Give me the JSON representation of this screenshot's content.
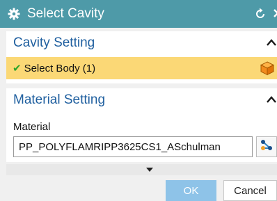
{
  "dialog": {
    "title": "Select Cavity",
    "title_bar_color": "#4e9aa8",
    "icons": [
      "gear-icon",
      "reset-icon",
      "close-icon"
    ]
  },
  "cavity_setting": {
    "header": "Cavity Setting",
    "select_label": "Select Body (1)",
    "highlight_color": "#fbd876",
    "icons": [
      "checkmark-icon",
      "cube-icon",
      "collapse-icon"
    ]
  },
  "material_setting": {
    "header": "Material Setting",
    "field_label": "Material",
    "value": "PP_POLYFLAMRIPP3625CS1_ASchulman",
    "icons": [
      "material-browse-icon",
      "collapse-icon"
    ]
  },
  "footer": {
    "ok_label": "OK",
    "cancel_label": "Cancel",
    "icons": [
      "expand-arrow-icon"
    ]
  }
}
